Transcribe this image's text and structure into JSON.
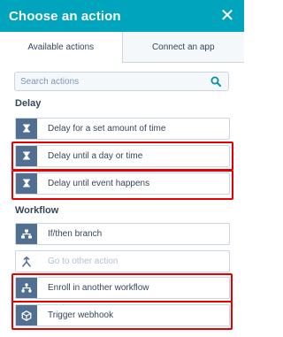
{
  "header": {
    "title": "Choose an action",
    "close_symbol": "✕"
  },
  "tabs": [
    {
      "label": "Available actions",
      "active": true
    },
    {
      "label": "Connect an app",
      "active": false
    }
  ],
  "search": {
    "placeholder": "Search actions"
  },
  "sections": {
    "delay": {
      "title": "Delay",
      "items": [
        {
          "label": "Delay for a set amount of time",
          "icon": "hourglass-icon"
        },
        {
          "label": "Delay until a day or time",
          "icon": "hourglass-icon"
        },
        {
          "label": "Delay until event happens",
          "icon": "hourglass-icon"
        }
      ]
    },
    "workflow": {
      "title": "Workflow",
      "items": [
        {
          "label": "If/then branch",
          "icon": "branch-icon"
        },
        {
          "label": "Go to other action",
          "icon": "go-to-action-icon"
        },
        {
          "label": "Enroll in another workflow",
          "icon": "workflow-icon"
        },
        {
          "label": "Trigger webhook",
          "icon": "webhook-icon"
        }
      ]
    }
  },
  "colors": {
    "header": "#00a4bd",
    "icon_bg": "#516f90",
    "highlight": "#e60000"
  }
}
